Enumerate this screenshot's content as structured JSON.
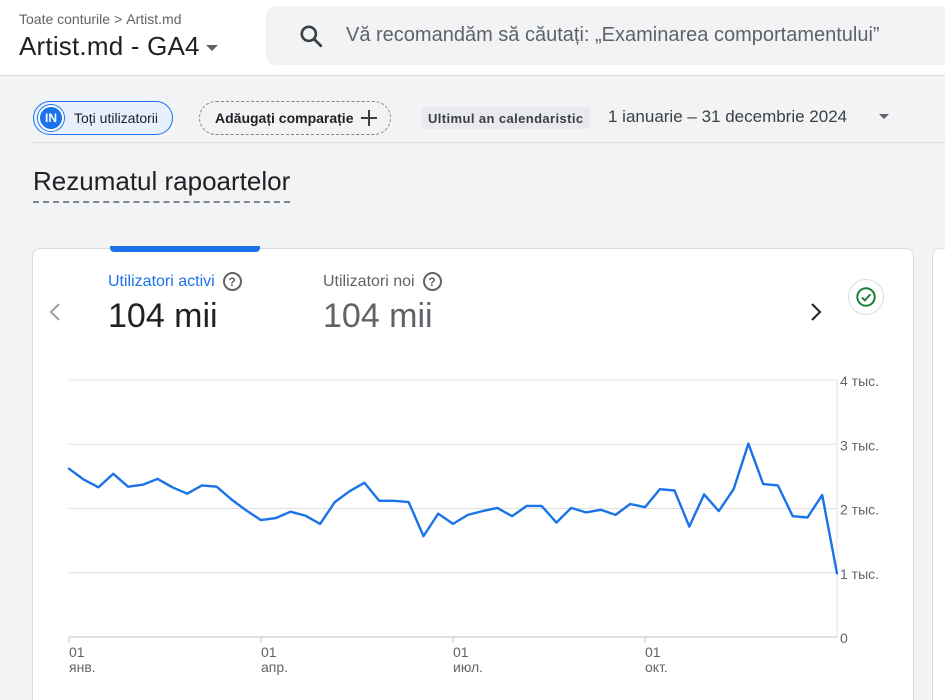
{
  "header": {
    "breadcrumb_root": "Toate conturile",
    "breadcrumb_account": "Artist.md",
    "property_name": "Artist.md - GA4",
    "search_placeholder": "Vă recomandăm să căutați: „Examinarea comportamentului”"
  },
  "toolbar": {
    "segment_avatar": "IN",
    "segment_label": "Toți utilizatorii",
    "compare_label": "Adăugați comparație",
    "date_badge": "Ultimul an calendaristic",
    "date_range": "1 ianuarie – 31 decembrie 2024"
  },
  "page": {
    "title": "Rezumatul rapoartelor"
  },
  "card": {
    "metrics": [
      {
        "label": "Utilizatori activi",
        "value": "104 mii"
      },
      {
        "label": "Utilizatori noi",
        "value": "104 mii"
      }
    ]
  },
  "colors": {
    "accent": "#1a73e8",
    "line": "#1a73e8",
    "success": "#188038",
    "grid": "#e0e0e0"
  },
  "icons": {
    "search": "search-icon",
    "prev": "chevron-left-icon",
    "next": "chevron-right-icon",
    "status": "check-circle-icon",
    "help": "help-icon",
    "add": "plus-icon",
    "dropdown": "caret-down-icon"
  },
  "chart_data": {
    "type": "line",
    "title": "",
    "xlabel": "",
    "ylabel": "",
    "ylim": [
      0,
      4000
    ],
    "yticks": [
      {
        "value": 0,
        "label": "0"
      },
      {
        "value": 1000,
        "label": "1 тыс."
      },
      {
        "value": 2000,
        "label": "2 тыс."
      },
      {
        "value": 3000,
        "label": "3 тыс."
      },
      {
        "value": 4000,
        "label": "4 тыс."
      }
    ],
    "xticks": [
      {
        "week": 0,
        "day": "01",
        "month": "янв."
      },
      {
        "week": 13,
        "day": "01",
        "month": "апр."
      },
      {
        "week": 26,
        "day": "01",
        "month": "июл."
      },
      {
        "week": 39,
        "day": "01",
        "month": "окт."
      }
    ],
    "grid": true,
    "series": [
      {
        "values": [
          2620,
          2450,
          2330,
          2540,
          2340,
          2370,
          2460,
          2330,
          2230,
          2360,
          2340,
          2140,
          1970,
          1820,
          1850,
          1950,
          1890,
          1760,
          2100,
          2270,
          2400,
          2120,
          2120,
          2100,
          1570,
          1920,
          1760,
          1900,
          1960,
          2010,
          1880,
          2040,
          2040,
          1780,
          2010,
          1940,
          1980,
          1900,
          2070,
          2020,
          2300,
          2280,
          1720,
          2220,
          1960,
          2300,
          3010,
          2380,
          2360,
          1880,
          1860,
          2210,
          990
        ]
      }
    ]
  }
}
